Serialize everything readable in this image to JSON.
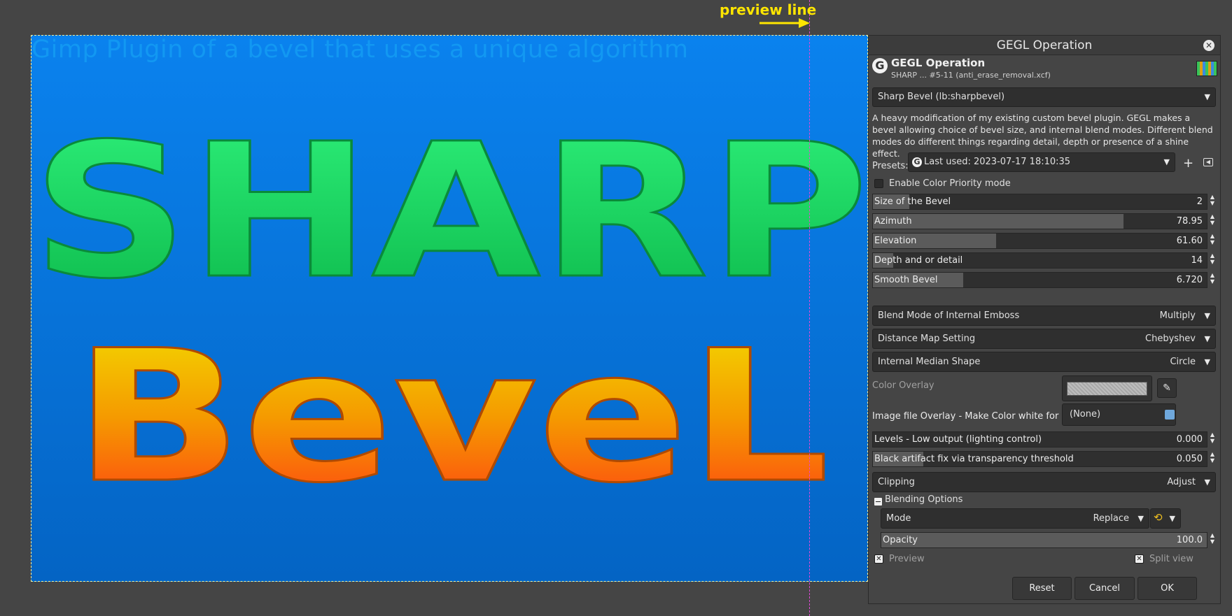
{
  "canvas": {
    "title": "Gimp Plugin of a bevel that uses a unique algorithm",
    "word1": "SHARP",
    "word2": "BeveL",
    "annotation": "preview line"
  },
  "colors": {
    "canvas_top": "#0a82ee",
    "canvas_bottom": "#0464c4",
    "green_text": "#18d65c",
    "yellow_text": "#f2d200",
    "red_text": "#ff4a14",
    "annotation": "#ffe600",
    "preview_line": "#e24ad8"
  },
  "dialog": {
    "window_title": "GEGL Operation",
    "header_title": "GEGL Operation",
    "header_subtitle": "SHARP ... #5-11 (anti_erase_removal.xcf)",
    "logo_icon": "gimp-gegl-icon",
    "operation": "Sharp Bevel (lb:sharpbevel)",
    "description": "A heavy modification of my existing custom bevel plugin. GEGL makes a bevel allowing choice of bevel size, and internal blend modes.  Different blend modes do different things regarding detail, depth or presence of a shine effect.",
    "presets_label": "Presets:",
    "presets_value": "Last used: 2023-07-17 18:10:35",
    "color_priority_label": "Enable Color Priority mode",
    "color_priority_checked": false,
    "sliders": [
      {
        "label": "Size of the Bevel",
        "value": "2",
        "fraction": 0.11
      },
      {
        "label": "Azimuth",
        "value": "78.95",
        "fraction": 0.75
      },
      {
        "label": "Elevation",
        "value": "61.60",
        "fraction": 0.37
      },
      {
        "label": "Depth and or detail",
        "value": "14",
        "fraction": 0.06
      },
      {
        "label": "Smooth Bevel",
        "value": "6.720",
        "fraction": 0.27
      }
    ],
    "blend_emboss": {
      "label": "Blend Mode of Internal Emboss",
      "value": "Multiply"
    },
    "distance_map": {
      "label": "Distance Map Setting",
      "value": "Chebyshev"
    },
    "median_shape": {
      "label": "Internal Median Shape",
      "value": "Circle"
    },
    "color_overlay_label": "Color Overlay",
    "image_overlay_label": "Image file Overlay - Make Color white for best results.",
    "image_overlay_value": "(None)",
    "levels": {
      "label": "Levels - Low output (lighting control)",
      "value": "0.000",
      "fraction": 0.0
    },
    "black_fix": {
      "label": "Black artifact fix via transparency threshold",
      "value": "0.050",
      "fraction": 0.15
    },
    "clipping": {
      "label": "Clipping",
      "value": "Adjust"
    },
    "blending_options_label": "Blending Options",
    "mode": {
      "label": "Mode",
      "value": "Replace"
    },
    "opacity": {
      "label": "Opacity",
      "value": "100.0",
      "fraction": 1.0
    },
    "preview_label": "Preview",
    "preview_checked": true,
    "split_label": "Split view",
    "split_checked": true,
    "buttons": {
      "reset": "Reset",
      "cancel": "Cancel",
      "ok": "OK"
    }
  }
}
